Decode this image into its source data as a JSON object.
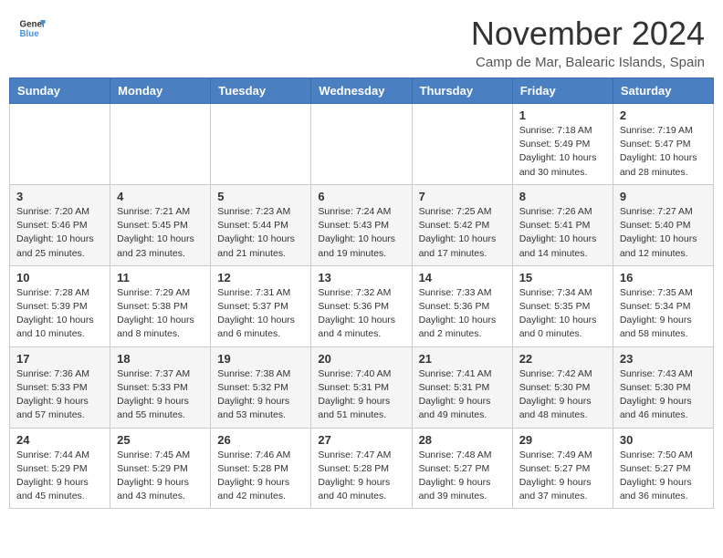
{
  "logo": {
    "line1": "General",
    "line2": "Blue"
  },
  "title": "November 2024",
  "location": "Camp de Mar, Balearic Islands, Spain",
  "days_of_week": [
    "Sunday",
    "Monday",
    "Tuesday",
    "Wednesday",
    "Thursday",
    "Friday",
    "Saturday"
  ],
  "weeks": [
    [
      {
        "day": "",
        "info": ""
      },
      {
        "day": "",
        "info": ""
      },
      {
        "day": "",
        "info": ""
      },
      {
        "day": "",
        "info": ""
      },
      {
        "day": "",
        "info": ""
      },
      {
        "day": "1",
        "info": "Sunrise: 7:18 AM\nSunset: 5:49 PM\nDaylight: 10 hours and 30 minutes."
      },
      {
        "day": "2",
        "info": "Sunrise: 7:19 AM\nSunset: 5:47 PM\nDaylight: 10 hours and 28 minutes."
      }
    ],
    [
      {
        "day": "3",
        "info": "Sunrise: 7:20 AM\nSunset: 5:46 PM\nDaylight: 10 hours and 25 minutes."
      },
      {
        "day": "4",
        "info": "Sunrise: 7:21 AM\nSunset: 5:45 PM\nDaylight: 10 hours and 23 minutes."
      },
      {
        "day": "5",
        "info": "Sunrise: 7:23 AM\nSunset: 5:44 PM\nDaylight: 10 hours and 21 minutes."
      },
      {
        "day": "6",
        "info": "Sunrise: 7:24 AM\nSunset: 5:43 PM\nDaylight: 10 hours and 19 minutes."
      },
      {
        "day": "7",
        "info": "Sunrise: 7:25 AM\nSunset: 5:42 PM\nDaylight: 10 hours and 17 minutes."
      },
      {
        "day": "8",
        "info": "Sunrise: 7:26 AM\nSunset: 5:41 PM\nDaylight: 10 hours and 14 minutes."
      },
      {
        "day": "9",
        "info": "Sunrise: 7:27 AM\nSunset: 5:40 PM\nDaylight: 10 hours and 12 minutes."
      }
    ],
    [
      {
        "day": "10",
        "info": "Sunrise: 7:28 AM\nSunset: 5:39 PM\nDaylight: 10 hours and 10 minutes."
      },
      {
        "day": "11",
        "info": "Sunrise: 7:29 AM\nSunset: 5:38 PM\nDaylight: 10 hours and 8 minutes."
      },
      {
        "day": "12",
        "info": "Sunrise: 7:31 AM\nSunset: 5:37 PM\nDaylight: 10 hours and 6 minutes."
      },
      {
        "day": "13",
        "info": "Sunrise: 7:32 AM\nSunset: 5:36 PM\nDaylight: 10 hours and 4 minutes."
      },
      {
        "day": "14",
        "info": "Sunrise: 7:33 AM\nSunset: 5:36 PM\nDaylight: 10 hours and 2 minutes."
      },
      {
        "day": "15",
        "info": "Sunrise: 7:34 AM\nSunset: 5:35 PM\nDaylight: 10 hours and 0 minutes."
      },
      {
        "day": "16",
        "info": "Sunrise: 7:35 AM\nSunset: 5:34 PM\nDaylight: 9 hours and 58 minutes."
      }
    ],
    [
      {
        "day": "17",
        "info": "Sunrise: 7:36 AM\nSunset: 5:33 PM\nDaylight: 9 hours and 57 minutes."
      },
      {
        "day": "18",
        "info": "Sunrise: 7:37 AM\nSunset: 5:33 PM\nDaylight: 9 hours and 55 minutes."
      },
      {
        "day": "19",
        "info": "Sunrise: 7:38 AM\nSunset: 5:32 PM\nDaylight: 9 hours and 53 minutes."
      },
      {
        "day": "20",
        "info": "Sunrise: 7:40 AM\nSunset: 5:31 PM\nDaylight: 9 hours and 51 minutes."
      },
      {
        "day": "21",
        "info": "Sunrise: 7:41 AM\nSunset: 5:31 PM\nDaylight: 9 hours and 49 minutes."
      },
      {
        "day": "22",
        "info": "Sunrise: 7:42 AM\nSunset: 5:30 PM\nDaylight: 9 hours and 48 minutes."
      },
      {
        "day": "23",
        "info": "Sunrise: 7:43 AM\nSunset: 5:30 PM\nDaylight: 9 hours and 46 minutes."
      }
    ],
    [
      {
        "day": "24",
        "info": "Sunrise: 7:44 AM\nSunset: 5:29 PM\nDaylight: 9 hours and 45 minutes."
      },
      {
        "day": "25",
        "info": "Sunrise: 7:45 AM\nSunset: 5:29 PM\nDaylight: 9 hours and 43 minutes."
      },
      {
        "day": "26",
        "info": "Sunrise: 7:46 AM\nSunset: 5:28 PM\nDaylight: 9 hours and 42 minutes."
      },
      {
        "day": "27",
        "info": "Sunrise: 7:47 AM\nSunset: 5:28 PM\nDaylight: 9 hours and 40 minutes."
      },
      {
        "day": "28",
        "info": "Sunrise: 7:48 AM\nSunset: 5:27 PM\nDaylight: 9 hours and 39 minutes."
      },
      {
        "day": "29",
        "info": "Sunrise: 7:49 AM\nSunset: 5:27 PM\nDaylight: 9 hours and 37 minutes."
      },
      {
        "day": "30",
        "info": "Sunrise: 7:50 AM\nSunset: 5:27 PM\nDaylight: 9 hours and 36 minutes."
      }
    ]
  ]
}
